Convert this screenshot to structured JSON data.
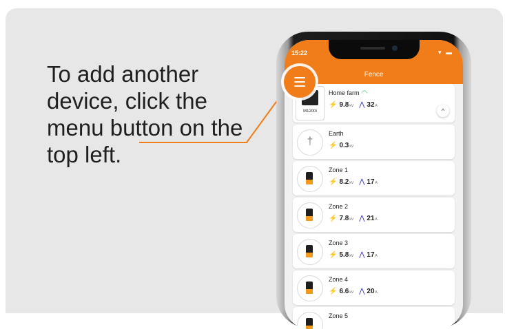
{
  "instruction": {
    "line1": "To add another",
    "line2": "device, click the",
    "line3": "menu button on the",
    "line4": "top left."
  },
  "status_bar": {
    "time": "15:22",
    "icons": "▾ ▬"
  },
  "app": {
    "title": "Fence",
    "accent": "#f07d1a"
  },
  "devices": [
    {
      "name": "Home farm",
      "model": "M1200i",
      "voltage": "9.8",
      "voltage_unit": "kV",
      "current": "32",
      "current_unit": "A"
    },
    {
      "name": "Earth",
      "voltage": "0.3",
      "voltage_unit": "kV"
    },
    {
      "name": "Zone 1",
      "voltage": "8.2",
      "voltage_unit": "kV",
      "current": "17",
      "current_unit": "A"
    },
    {
      "name": "Zone 2",
      "voltage": "7.8",
      "voltage_unit": "kV",
      "current": "21",
      "current_unit": "A"
    },
    {
      "name": "Zone 3",
      "voltage": "5.8",
      "voltage_unit": "kV",
      "current": "17",
      "current_unit": "A"
    },
    {
      "name": "Zone 4",
      "voltage": "6.6",
      "voltage_unit": "kV",
      "current": "20",
      "current_unit": "A"
    },
    {
      "name": "Zone 5"
    }
  ],
  "icons": {
    "menu": "hamburger-menu-icon",
    "bolt": "⚡",
    "wave": "⋀",
    "earth": "†",
    "wifi": "wifi-icon",
    "collapse": "^"
  }
}
